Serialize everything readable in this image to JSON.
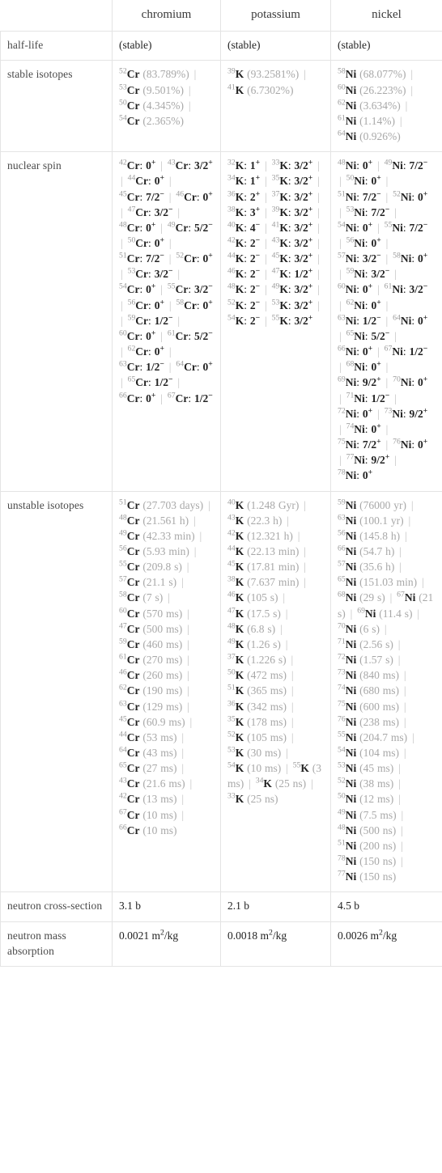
{
  "table": {
    "columns": [
      "chromium",
      "potassium",
      "nickel"
    ],
    "row_labels": {
      "half_life": "half-life",
      "stable_isotopes": "stable isotopes",
      "nuclear_spin": "nuclear spin",
      "unstable_isotopes": "unstable isotopes",
      "neutron_cross_section": "neutron cross-section",
      "neutron_mass_absorption": "neutron mass absorption"
    },
    "half_life": {
      "chromium": "(stable)",
      "potassium": "(stable)",
      "nickel": "(stable)"
    },
    "stable_isotopes": {
      "chromium": [
        {
          "a": "52",
          "sym": "Cr",
          "val": "(83.789%)"
        },
        {
          "a": "53",
          "sym": "Cr",
          "val": "(9.501%)"
        },
        {
          "a": "50",
          "sym": "Cr",
          "val": "(4.345%)"
        },
        {
          "a": "54",
          "sym": "Cr",
          "val": "(2.365%)"
        }
      ],
      "potassium": [
        {
          "a": "39",
          "sym": "K",
          "val": "(93.2581%)"
        },
        {
          "a": "41",
          "sym": "K",
          "val": "(6.7302%)"
        }
      ],
      "nickel": [
        {
          "a": "58",
          "sym": "Ni",
          "val": "(68.077%)"
        },
        {
          "a": "60",
          "sym": "Ni",
          "val": "(26.223%)"
        },
        {
          "a": "62",
          "sym": "Ni",
          "val": "(3.634%)"
        },
        {
          "a": "61",
          "sym": "Ni",
          "val": "(1.14%)"
        },
        {
          "a": "64",
          "sym": "Ni",
          "val": "(0.926%)"
        }
      ]
    },
    "nuclear_spin": {
      "chromium": [
        {
          "a": "42",
          "sym": "Cr",
          "spin": "0",
          "sign": "+"
        },
        {
          "a": "43",
          "sym": "Cr",
          "spin": "3/2",
          "sign": "+"
        },
        {
          "a": "44",
          "sym": "Cr",
          "spin": "0",
          "sign": "+"
        },
        {
          "a": "45",
          "sym": "Cr",
          "spin": "7/2",
          "sign": "−"
        },
        {
          "a": "46",
          "sym": "Cr",
          "spin": "0",
          "sign": "+"
        },
        {
          "a": "47",
          "sym": "Cr",
          "spin": "3/2",
          "sign": "−"
        },
        {
          "a": "48",
          "sym": "Cr",
          "spin": "0",
          "sign": "+"
        },
        {
          "a": "49",
          "sym": "Cr",
          "spin": "5/2",
          "sign": "−"
        },
        {
          "a": "50",
          "sym": "Cr",
          "spin": "0",
          "sign": "+"
        },
        {
          "a": "51",
          "sym": "Cr",
          "spin": "7/2",
          "sign": "−"
        },
        {
          "a": "52",
          "sym": "Cr",
          "spin": "0",
          "sign": "+"
        },
        {
          "a": "53",
          "sym": "Cr",
          "spin": "3/2",
          "sign": "−"
        },
        {
          "a": "54",
          "sym": "Cr",
          "spin": "0",
          "sign": "+"
        },
        {
          "a": "55",
          "sym": "Cr",
          "spin": "3/2",
          "sign": "−"
        },
        {
          "a": "56",
          "sym": "Cr",
          "spin": "0",
          "sign": "+"
        },
        {
          "a": "58",
          "sym": "Cr",
          "spin": "0",
          "sign": "+"
        },
        {
          "a": "59",
          "sym": "Cr",
          "spin": "1/2",
          "sign": "−"
        },
        {
          "a": "60",
          "sym": "Cr",
          "spin": "0",
          "sign": "+"
        },
        {
          "a": "61",
          "sym": "Cr",
          "spin": "5/2",
          "sign": "−"
        },
        {
          "a": "62",
          "sym": "Cr",
          "spin": "0",
          "sign": "+"
        },
        {
          "a": "63",
          "sym": "Cr",
          "spin": "1/2",
          "sign": "−"
        },
        {
          "a": "64",
          "sym": "Cr",
          "spin": "0",
          "sign": "+"
        },
        {
          "a": "65",
          "sym": "Cr",
          "spin": "1/2",
          "sign": "−"
        },
        {
          "a": "66",
          "sym": "Cr",
          "spin": "0",
          "sign": "+"
        },
        {
          "a": "67",
          "sym": "Cr",
          "spin": "1/2",
          "sign": "−"
        }
      ],
      "potassium": [
        {
          "a": "32",
          "sym": "K",
          "spin": "1",
          "sign": "+"
        },
        {
          "a": "33",
          "sym": "K",
          "spin": "3/2",
          "sign": "+"
        },
        {
          "a": "34",
          "sym": "K",
          "spin": "1",
          "sign": "+"
        },
        {
          "a": "35",
          "sym": "K",
          "spin": "3/2",
          "sign": "+"
        },
        {
          "a": "36",
          "sym": "K",
          "spin": "2",
          "sign": "+"
        },
        {
          "a": "37",
          "sym": "K",
          "spin": "3/2",
          "sign": "+"
        },
        {
          "a": "38",
          "sym": "K",
          "spin": "3",
          "sign": "+"
        },
        {
          "a": "39",
          "sym": "K",
          "spin": "3/2",
          "sign": "+"
        },
        {
          "a": "40",
          "sym": "K",
          "spin": "4",
          "sign": "−"
        },
        {
          "a": "41",
          "sym": "K",
          "spin": "3/2",
          "sign": "+"
        },
        {
          "a": "42",
          "sym": "K",
          "spin": "2",
          "sign": "−"
        },
        {
          "a": "43",
          "sym": "K",
          "spin": "3/2",
          "sign": "+"
        },
        {
          "a": "44",
          "sym": "K",
          "spin": "2",
          "sign": "−"
        },
        {
          "a": "45",
          "sym": "K",
          "spin": "3/2",
          "sign": "+"
        },
        {
          "a": "46",
          "sym": "K",
          "spin": "2",
          "sign": "−"
        },
        {
          "a": "47",
          "sym": "K",
          "spin": "1/2",
          "sign": "+"
        },
        {
          "a": "48",
          "sym": "K",
          "spin": "2",
          "sign": "−"
        },
        {
          "a": "49",
          "sym": "K",
          "spin": "3/2",
          "sign": "+"
        },
        {
          "a": "52",
          "sym": "K",
          "spin": "2",
          "sign": "−"
        },
        {
          "a": "53",
          "sym": "K",
          "spin": "3/2",
          "sign": "+"
        },
        {
          "a": "54",
          "sym": "K",
          "spin": "2",
          "sign": "−"
        },
        {
          "a": "55",
          "sym": "K",
          "spin": "3/2",
          "sign": "+"
        }
      ],
      "nickel": [
        {
          "a": "48",
          "sym": "Ni",
          "spin": "0",
          "sign": "+"
        },
        {
          "a": "49",
          "sym": "Ni",
          "spin": "7/2",
          "sign": "−"
        },
        {
          "a": "50",
          "sym": "Ni",
          "spin": "0",
          "sign": "+"
        },
        {
          "a": "51",
          "sym": "Ni",
          "spin": "7/2",
          "sign": "−"
        },
        {
          "a": "52",
          "sym": "Ni",
          "spin": "0",
          "sign": "+"
        },
        {
          "a": "53",
          "sym": "Ni",
          "spin": "7/2",
          "sign": "−"
        },
        {
          "a": "54",
          "sym": "Ni",
          "spin": "0",
          "sign": "+"
        },
        {
          "a": "55",
          "sym": "Ni",
          "spin": "7/2",
          "sign": "−"
        },
        {
          "a": "56",
          "sym": "Ni",
          "spin": "0",
          "sign": "+"
        },
        {
          "a": "57",
          "sym": "Ni",
          "spin": "3/2",
          "sign": "−"
        },
        {
          "a": "58",
          "sym": "Ni",
          "spin": "0",
          "sign": "+"
        },
        {
          "a": "59",
          "sym": "Ni",
          "spin": "3/2",
          "sign": "−"
        },
        {
          "a": "60",
          "sym": "Ni",
          "spin": "0",
          "sign": "+"
        },
        {
          "a": "61",
          "sym": "Ni",
          "spin": "3/2",
          "sign": "−"
        },
        {
          "a": "62",
          "sym": "Ni",
          "spin": "0",
          "sign": "+"
        },
        {
          "a": "63",
          "sym": "Ni",
          "spin": "1/2",
          "sign": "−"
        },
        {
          "a": "64",
          "sym": "Ni",
          "spin": "0",
          "sign": "+"
        },
        {
          "a": "65",
          "sym": "Ni",
          "spin": "5/2",
          "sign": "−"
        },
        {
          "a": "66",
          "sym": "Ni",
          "spin": "0",
          "sign": "+"
        },
        {
          "a": "67",
          "sym": "Ni",
          "spin": "1/2",
          "sign": "−"
        },
        {
          "a": "68",
          "sym": "Ni",
          "spin": "0",
          "sign": "+"
        },
        {
          "a": "69",
          "sym": "Ni",
          "spin": "9/2",
          "sign": "+"
        },
        {
          "a": "70",
          "sym": "Ni",
          "spin": "0",
          "sign": "+"
        },
        {
          "a": "71",
          "sym": "Ni",
          "spin": "1/2",
          "sign": "−"
        },
        {
          "a": "72",
          "sym": "Ni",
          "spin": "0",
          "sign": "+"
        },
        {
          "a": "73",
          "sym": "Ni",
          "spin": "9/2",
          "sign": "+"
        },
        {
          "a": "74",
          "sym": "Ni",
          "spin": "0",
          "sign": "+"
        },
        {
          "a": "75",
          "sym": "Ni",
          "spin": "7/2",
          "sign": "+"
        },
        {
          "a": "76",
          "sym": "Ni",
          "spin": "0",
          "sign": "+"
        },
        {
          "a": "77",
          "sym": "Ni",
          "spin": "9/2",
          "sign": "+"
        },
        {
          "a": "78",
          "sym": "Ni",
          "spin": "0",
          "sign": "+"
        }
      ]
    },
    "unstable_isotopes": {
      "chromium": [
        {
          "a": "51",
          "sym": "Cr",
          "val": "(27.703 days)"
        },
        {
          "a": "48",
          "sym": "Cr",
          "val": "(21.561 h)"
        },
        {
          "a": "49",
          "sym": "Cr",
          "val": "(42.33 min)"
        },
        {
          "a": "56",
          "sym": "Cr",
          "val": "(5.93 min)"
        },
        {
          "a": "55",
          "sym": "Cr",
          "val": "(209.8 s)"
        },
        {
          "a": "57",
          "sym": "Cr",
          "val": "(21.1 s)"
        },
        {
          "a": "58",
          "sym": "Cr",
          "val": "(7 s)"
        },
        {
          "a": "60",
          "sym": "Cr",
          "val": "(570 ms)"
        },
        {
          "a": "47",
          "sym": "Cr",
          "val": "(500 ms)"
        },
        {
          "a": "59",
          "sym": "Cr",
          "val": "(460 ms)"
        },
        {
          "a": "61",
          "sym": "Cr",
          "val": "(270 ms)"
        },
        {
          "a": "46",
          "sym": "Cr",
          "val": "(260 ms)"
        },
        {
          "a": "62",
          "sym": "Cr",
          "val": "(190 ms)"
        },
        {
          "a": "63",
          "sym": "Cr",
          "val": "(129 ms)"
        },
        {
          "a": "45",
          "sym": "Cr",
          "val": "(60.9 ms)"
        },
        {
          "a": "44",
          "sym": "Cr",
          "val": "(53 ms)"
        },
        {
          "a": "64",
          "sym": "Cr",
          "val": "(43 ms)"
        },
        {
          "a": "65",
          "sym": "Cr",
          "val": "(27 ms)"
        },
        {
          "a": "43",
          "sym": "Cr",
          "val": "(21.6 ms)"
        },
        {
          "a": "42",
          "sym": "Cr",
          "val": "(13 ms)"
        },
        {
          "a": "67",
          "sym": "Cr",
          "val": "(10 ms)"
        },
        {
          "a": "66",
          "sym": "Cr",
          "val": "(10 ms)"
        }
      ],
      "potassium": [
        {
          "a": "40",
          "sym": "K",
          "val": "(1.248 Gyr)"
        },
        {
          "a": "43",
          "sym": "K",
          "val": "(22.3 h)"
        },
        {
          "a": "42",
          "sym": "K",
          "val": "(12.321 h)"
        },
        {
          "a": "44",
          "sym": "K",
          "val": "(22.13 min)"
        },
        {
          "a": "45",
          "sym": "K",
          "val": "(17.81 min)"
        },
        {
          "a": "38",
          "sym": "K",
          "val": "(7.637 min)"
        },
        {
          "a": "46",
          "sym": "K",
          "val": "(105 s)"
        },
        {
          "a": "47",
          "sym": "K",
          "val": "(17.5 s)"
        },
        {
          "a": "48",
          "sym": "K",
          "val": "(6.8 s)"
        },
        {
          "a": "49",
          "sym": "K",
          "val": "(1.26 s)"
        },
        {
          "a": "37",
          "sym": "K",
          "val": "(1.226 s)"
        },
        {
          "a": "50",
          "sym": "K",
          "val": "(472 ms)"
        },
        {
          "a": "51",
          "sym": "K",
          "val": "(365 ms)"
        },
        {
          "a": "36",
          "sym": "K",
          "val": "(342 ms)"
        },
        {
          "a": "35",
          "sym": "K",
          "val": "(178 ms)"
        },
        {
          "a": "52",
          "sym": "K",
          "val": "(105 ms)"
        },
        {
          "a": "53",
          "sym": "K",
          "val": "(30 ms)"
        },
        {
          "a": "54",
          "sym": "K",
          "val": "(10 ms)"
        },
        {
          "a": "55",
          "sym": "K",
          "val": "(3 ms)"
        },
        {
          "a": "34",
          "sym": "K",
          "val": "(25 ns)"
        },
        {
          "a": "33",
          "sym": "K",
          "val": "(25 ns)"
        }
      ],
      "nickel": [
        {
          "a": "59",
          "sym": "Ni",
          "val": "(76000 yr)"
        },
        {
          "a": "63",
          "sym": "Ni",
          "val": "(100.1 yr)"
        },
        {
          "a": "56",
          "sym": "Ni",
          "val": "(145.8 h)"
        },
        {
          "a": "66",
          "sym": "Ni",
          "val": "(54.7 h)"
        },
        {
          "a": "57",
          "sym": "Ni",
          "val": "(35.6 h)"
        },
        {
          "a": "65",
          "sym": "Ni",
          "val": "(151.03 min)"
        },
        {
          "a": "68",
          "sym": "Ni",
          "val": "(29 s)"
        },
        {
          "a": "67",
          "sym": "Ni",
          "val": "(21 s)"
        },
        {
          "a": "69",
          "sym": "Ni",
          "val": "(11.4 s)"
        },
        {
          "a": "70",
          "sym": "Ni",
          "val": "(6 s)"
        },
        {
          "a": "71",
          "sym": "Ni",
          "val": "(2.56 s)"
        },
        {
          "a": "72",
          "sym": "Ni",
          "val": "(1.57 s)"
        },
        {
          "a": "73",
          "sym": "Ni",
          "val": "(840 ms)"
        },
        {
          "a": "74",
          "sym": "Ni",
          "val": "(680 ms)"
        },
        {
          "a": "75",
          "sym": "Ni",
          "val": "(600 ms)"
        },
        {
          "a": "76",
          "sym": "Ni",
          "val": "(238 ms)"
        },
        {
          "a": "55",
          "sym": "Ni",
          "val": "(204.7 ms)"
        },
        {
          "a": "54",
          "sym": "Ni",
          "val": "(104 ms)"
        },
        {
          "a": "53",
          "sym": "Ni",
          "val": "(45 ms)"
        },
        {
          "a": "52",
          "sym": "Ni",
          "val": "(38 ms)"
        },
        {
          "a": "50",
          "sym": "Ni",
          "val": "(12 ms)"
        },
        {
          "a": "49",
          "sym": "Ni",
          "val": "(7.5 ms)"
        },
        {
          "a": "48",
          "sym": "Ni",
          "val": "(500 ns)"
        },
        {
          "a": "51",
          "sym": "Ni",
          "val": "(200 ns)"
        },
        {
          "a": "78",
          "sym": "Ni",
          "val": "(150 ns)"
        },
        {
          "a": "77",
          "sym": "Ni",
          "val": "(150 ns)"
        }
      ]
    },
    "neutron_cross_section": {
      "chromium": "3.1 b",
      "potassium": "2.1 b",
      "nickel": "4.5 b"
    },
    "neutron_mass_absorption": {
      "chromium": {
        "num": "0.0021 m",
        "exp": "2",
        "denom": "/kg"
      },
      "potassium": {
        "num": "0.0018 m",
        "exp": "2",
        "denom": "/kg"
      },
      "nickel": {
        "num": "0.0026 m",
        "exp": "2",
        "denom": "/kg"
      }
    }
  }
}
